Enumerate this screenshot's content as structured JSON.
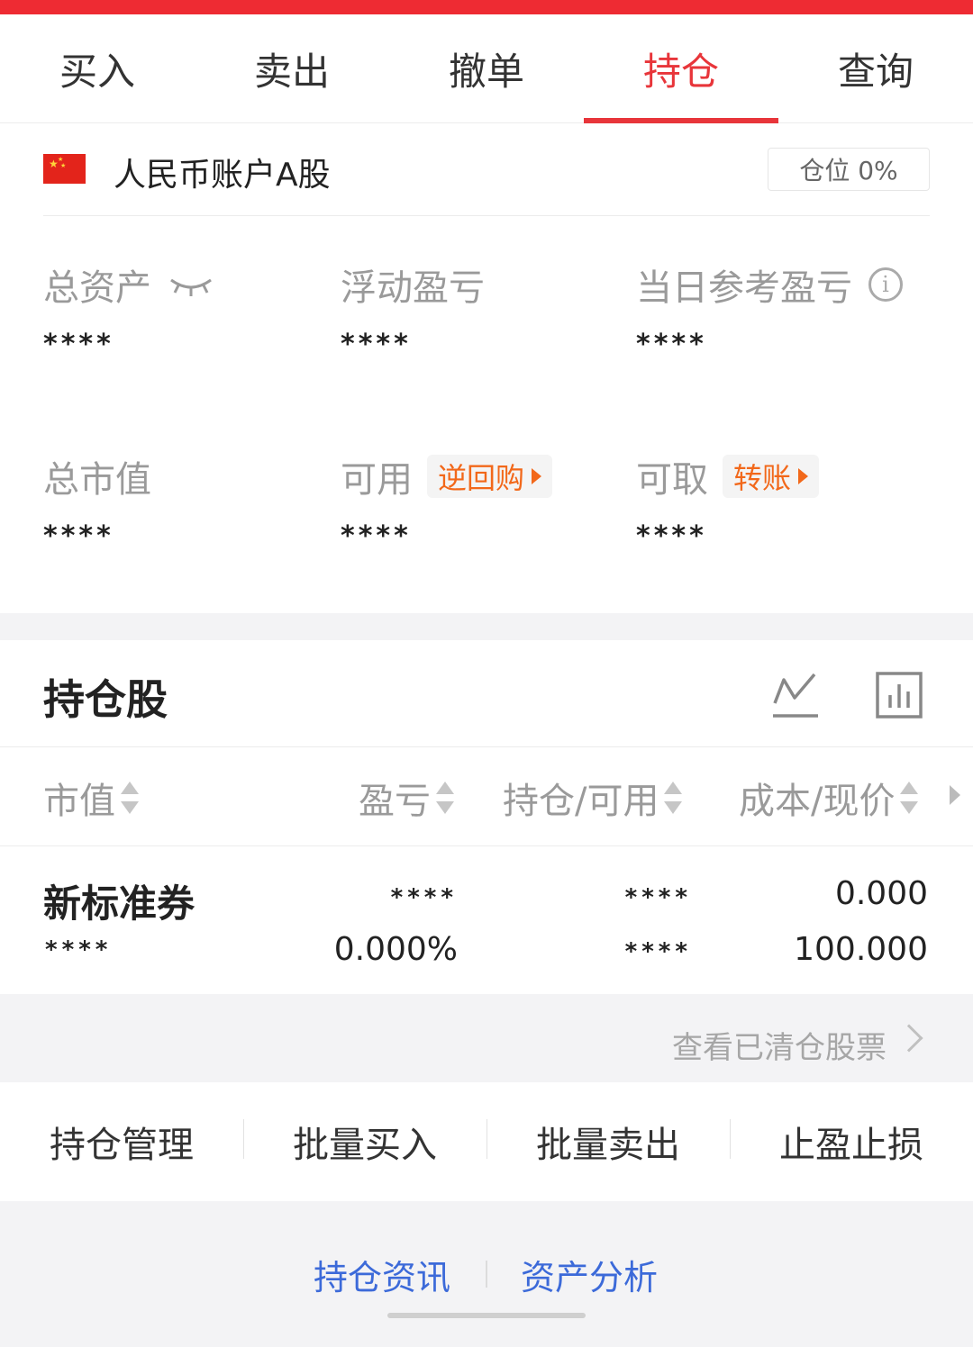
{
  "tabs": [
    {
      "label": "买入",
      "active": false
    },
    {
      "label": "卖出",
      "active": false
    },
    {
      "label": "撤单",
      "active": false
    },
    {
      "label": "持仓",
      "active": true
    },
    {
      "label": "查询",
      "active": false
    }
  ],
  "colors": {
    "accent": "#e8353a",
    "orange": "#f2681a",
    "link": "#3c6ad9"
  },
  "account": {
    "flag_icon": "china-flag-icon",
    "name": "人民币账户A股",
    "position_badge": "仓位 0%",
    "stats": {
      "total_assets": {
        "label": "总资产",
        "value": "****",
        "icon": "eye-closed-icon"
      },
      "floating_pl": {
        "label": "浮动盈亏",
        "value": "****"
      },
      "daily_pl": {
        "label": "当日参考盈亏",
        "value": "****",
        "icon": "info-icon"
      },
      "market_value": {
        "label": "总市值",
        "value": "****"
      },
      "available": {
        "label": "可用",
        "value": "****",
        "action": "逆回购"
      },
      "withdrawable": {
        "label": "可取",
        "value": "****",
        "action": "转账"
      }
    }
  },
  "holdings": {
    "title": "持仓股",
    "icons": [
      "line-chart-icon",
      "bar-chart-icon"
    ],
    "columns": [
      "市值",
      "盈亏",
      "持仓/可用",
      "成本/现价"
    ],
    "rows": [
      {
        "name": "新标准券",
        "market_value": "****",
        "pl": "****",
        "pl_pct": "0.000%",
        "position": "****",
        "available": "****",
        "cost": "0.000",
        "price": "100.000"
      }
    ],
    "cleared_link": "查看已清仓股票"
  },
  "actions": [
    "持仓管理",
    "批量买入",
    "批量卖出",
    "止盈止损"
  ],
  "links": [
    "持仓资讯",
    "资产分析"
  ]
}
